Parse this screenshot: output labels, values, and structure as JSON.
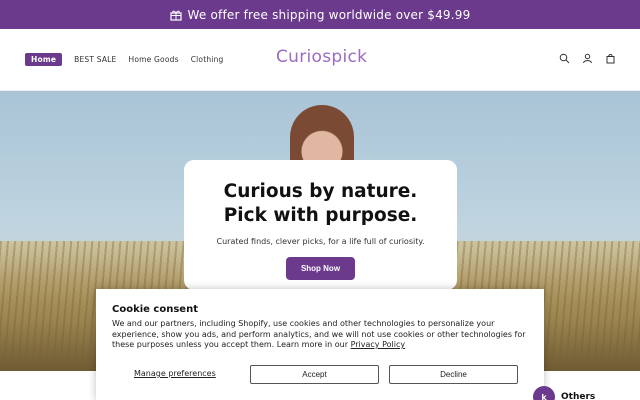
{
  "announcement": {
    "text": "We offer free shipping worldwide over $49.99",
    "icon": "gift-icon"
  },
  "header": {
    "logo": "Curiospick",
    "nav": [
      {
        "label": "Home",
        "active": true
      },
      {
        "label": "BEST SALE",
        "active": false
      },
      {
        "label": "Home Goods",
        "active": false
      },
      {
        "label": "Clothing",
        "active": false
      }
    ],
    "icons": [
      "search-icon",
      "account-icon",
      "cart-icon"
    ]
  },
  "hero": {
    "heading_line1": "Curious by nature.",
    "heading_line2": "Pick with purpose.",
    "subtext": "Curated finds, clever picks, for a life full of curiosity.",
    "cta": "Shop Now"
  },
  "cookie": {
    "title": "Cookie consent",
    "body": "We and our partners, including Shopify, use cookies and other technologies to personalize your experience, show you ads, and perform analytics, and we will not use cookies or other technologies for these purposes unless you accept them. Learn more in our",
    "policy_link": "Privacy Policy",
    "manage": "Manage preferences",
    "accept": "Accept",
    "decline": "Decline"
  },
  "floating": {
    "badge": "k",
    "label": "Others"
  },
  "colors": {
    "brand": "#6b3a8c",
    "logo": "#9b6bbf"
  }
}
